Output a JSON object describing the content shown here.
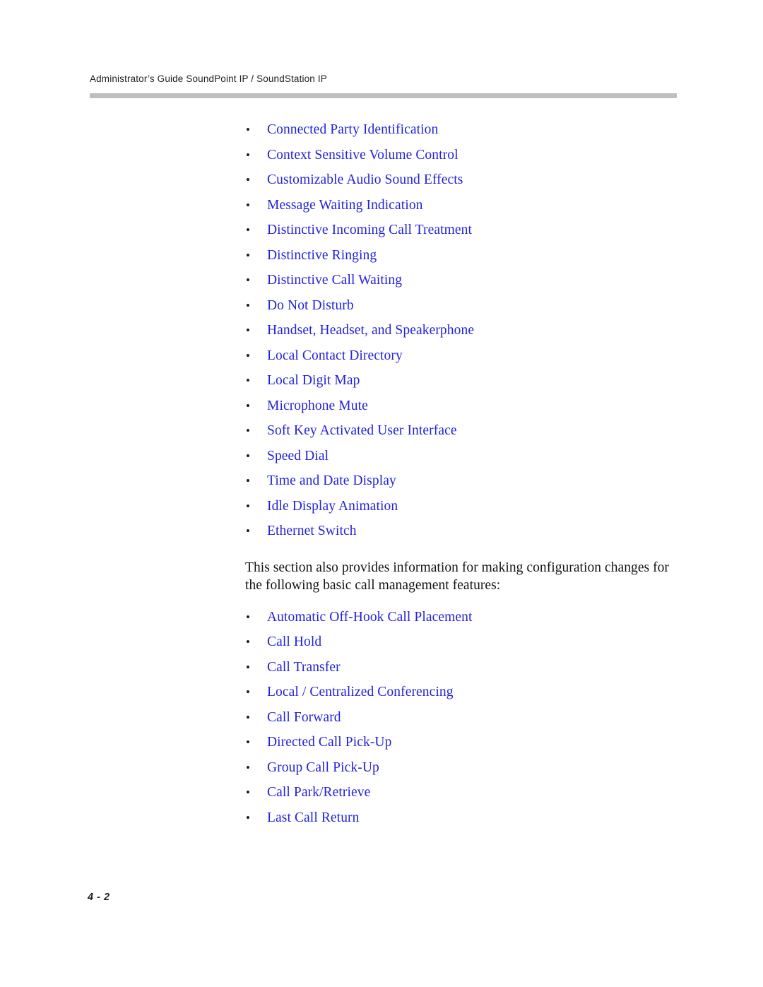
{
  "document": {
    "running_header": "Administrator’s Guide SoundPoint IP / SoundStation IP",
    "page_number": "4 - 2",
    "link_color": "#2222dd",
    "text_color": "#141414",
    "rule_color": "#bfbfbf",
    "bullet_glyph": "•"
  },
  "feature_list": [
    {
      "label": "Connected Party Identification"
    },
    {
      "label": "Context Sensitive Volume Control"
    },
    {
      "label": "Customizable Audio Sound Effects"
    },
    {
      "label": "Message Waiting Indication"
    },
    {
      "label": "Distinctive Incoming Call Treatment"
    },
    {
      "label": "Distinctive Ringing"
    },
    {
      "label": "Distinctive Call Waiting"
    },
    {
      "label": "Do Not Disturb"
    },
    {
      "label": "Handset, Headset, and Speakerphone"
    },
    {
      "label": "Local Contact Directory"
    },
    {
      "label": "Local Digit Map"
    },
    {
      "label": "Microphone Mute"
    },
    {
      "label": "Soft Key Activated User Interface"
    },
    {
      "label": "Speed Dial"
    },
    {
      "label": "Time and Date Display"
    },
    {
      "label": "Idle Display Animation"
    },
    {
      "label": "Ethernet Switch"
    }
  ],
  "paragraph": {
    "text": "This section also provides information for making configuration changes for the following basic call management features:"
  },
  "call_management_list": [
    {
      "label": "Automatic Off-Hook Call Placement"
    },
    {
      "label": "Call Hold"
    },
    {
      "label": "Call Transfer"
    },
    {
      "label": "Local / Centralized Conferencing"
    },
    {
      "label": "Call Forward"
    },
    {
      "label": "Directed Call Pick-Up"
    },
    {
      "label": "Group Call Pick-Up"
    },
    {
      "label": "Call Park/Retrieve"
    },
    {
      "label": "Last Call Return"
    }
  ]
}
